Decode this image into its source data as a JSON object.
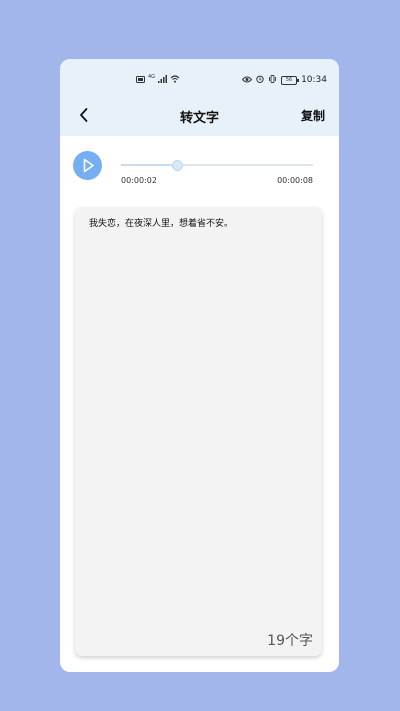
{
  "status_bar": {
    "left_icons": [
      "hd-icon",
      "4g-icon",
      "signal-icon",
      "wifi-icon"
    ],
    "network_label": "4G",
    "right_icons": [
      "eye-icon",
      "alarm-icon",
      "vibrate-icon",
      "battery-icon"
    ],
    "battery_label": "56",
    "time": "10:34"
  },
  "header": {
    "title": "转文字",
    "copy_label": "复制"
  },
  "player": {
    "current_time": "00:00:02",
    "total_time": "00:00:08",
    "progress_fraction": 0.29,
    "accent_color": "#76aef4"
  },
  "content": {
    "text": "我失恋，在夜深人里，想着省不安。",
    "char_count": "19个字"
  },
  "colors": {
    "background": "#a3b6ec",
    "header_bg": "#e6f1f9",
    "card_bg": "#f3f3f3"
  }
}
